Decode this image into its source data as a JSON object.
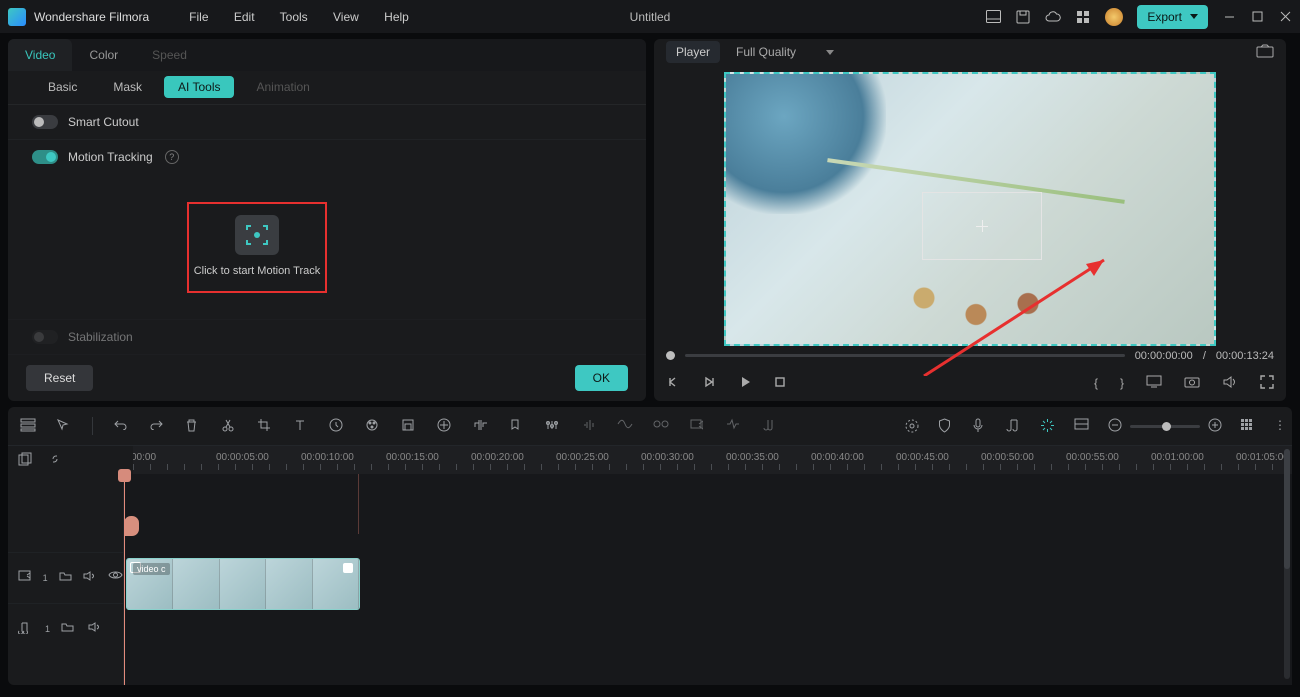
{
  "app": {
    "name": "Wondershare Filmora",
    "document": "Untitled"
  },
  "menu": {
    "file": "File",
    "edit": "Edit",
    "tools": "Tools",
    "view": "View",
    "help": "Help"
  },
  "export": {
    "label": "Export"
  },
  "left_panel": {
    "tabs": {
      "video": "Video",
      "color": "Color",
      "speed": "Speed"
    },
    "subtabs": {
      "basic": "Basic",
      "mask": "Mask",
      "ai_tools": "AI Tools",
      "animation": "Animation"
    },
    "smart_cutout": {
      "label": "Smart Cutout",
      "on": false
    },
    "motion_tracking": {
      "label": "Motion Tracking",
      "on": true
    },
    "motion_btn_text": "Click to start Motion Track",
    "stabilization": {
      "label": "Stabilization",
      "on": false
    },
    "reset": "Reset",
    "ok": "OK"
  },
  "player": {
    "tab": "Player",
    "quality": "Full Quality",
    "time_current": "00:00:00:00",
    "time_sep": "/",
    "time_total": "00:00:13:24"
  },
  "timeline": {
    "ruler": [
      "00:00",
      "00:00:05:00",
      "00:00:10:00",
      "00:00:15:00",
      "00:00:20:00",
      "00:00:25:00",
      "00:00:30:00",
      "00:00:35:00",
      "00:00:40:00",
      "00:00:45:00",
      "00:00:50:00",
      "00:00:55:00",
      "00:01:00:00",
      "00:01:05:00"
    ],
    "clip_label": "video c",
    "video_track": "1",
    "audio_track": "1"
  }
}
